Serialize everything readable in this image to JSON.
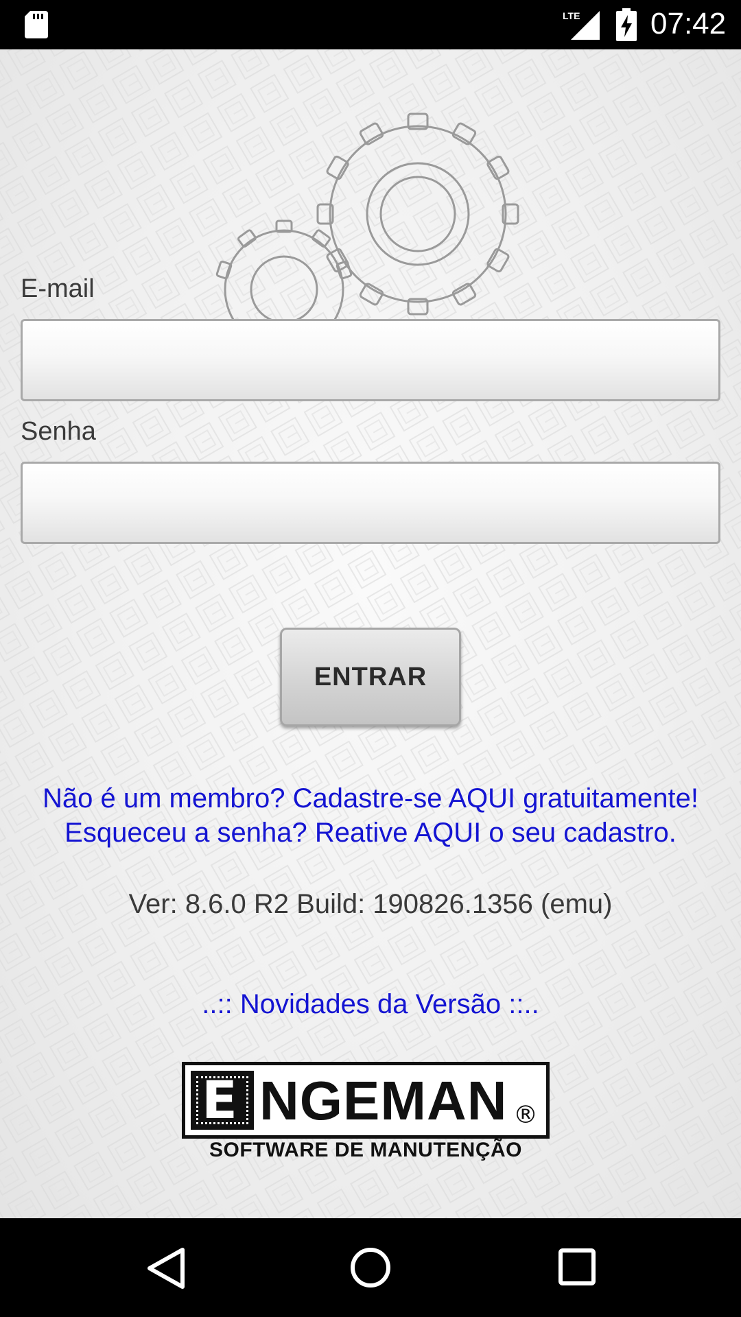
{
  "status_bar": {
    "time": "07:42",
    "network": "LTE",
    "icons": [
      "sd-card-icon",
      "lte-signal-icon",
      "battery-charging-icon"
    ]
  },
  "form": {
    "email_label": "E-mail",
    "email_value": "",
    "password_label": "Senha",
    "password_value": "",
    "submit_label": "ENTRAR"
  },
  "links": {
    "register": "Não é um membro? Cadastre-se AQUI gratuitamente!",
    "reactivate": "Esqueceu a senha? Reative AQUI o seu cadastro.",
    "release_notes": "..:: Novidades da Versão ::.."
  },
  "version_text": "Ver: 8.6.0  R2 Build: 190826.1356 (emu)",
  "logo": {
    "letter": "E",
    "name": "NGEMAN",
    "registered": "®",
    "tagline": "SOFTWARE DE MANUTENÇÃO"
  },
  "nav_bar": {
    "icons": [
      "back-icon",
      "home-icon",
      "recents-icon"
    ]
  },
  "colors": {
    "link": "#1414d2",
    "text": "#3a3a3a",
    "background": "#f0f0f0",
    "bars": "#000000"
  }
}
